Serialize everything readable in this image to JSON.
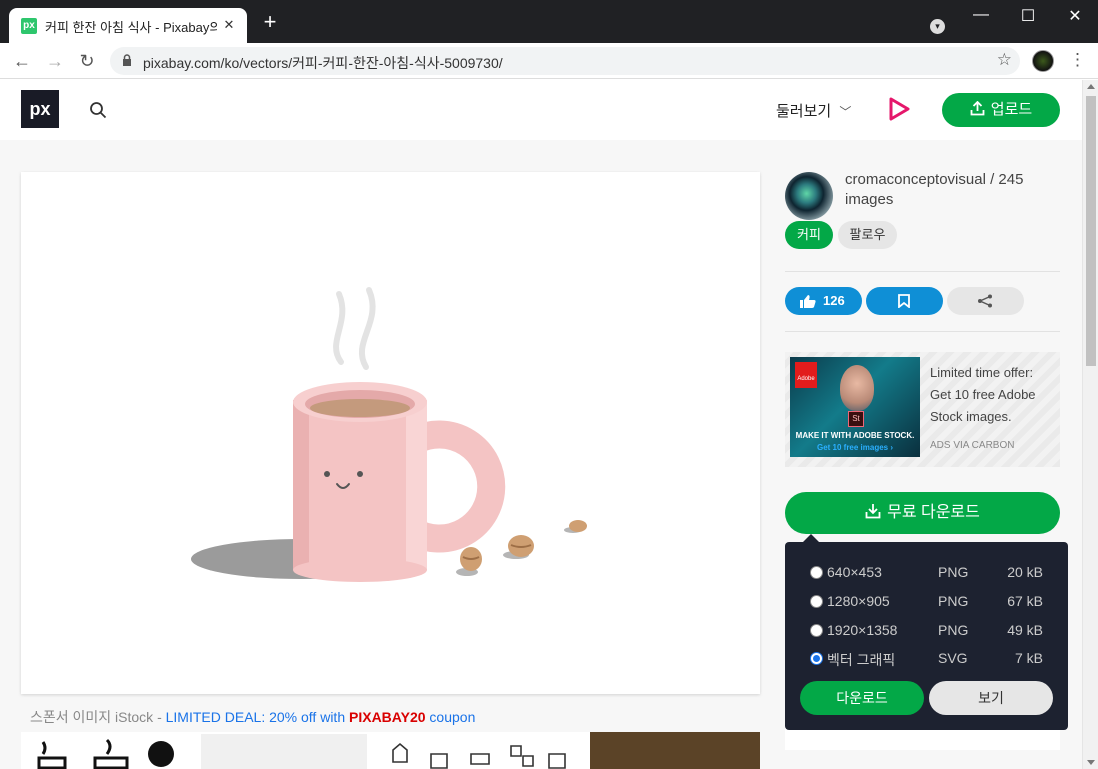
{
  "browser": {
    "tab_title": "커피 한잔 아침 식사 - Pixabay의",
    "tab_favicon": "px",
    "url": "pixabay.com/ko/vectors/커피-커피-한잔-아침-식사-5009730/"
  },
  "header": {
    "logo": "px",
    "explore_label": "둘러보기",
    "upload_label": "업로드"
  },
  "author": {
    "name_line": "cromaconceptovisual / 245 images",
    "coffee_label": "커피",
    "follow_label": "팔로우"
  },
  "actions": {
    "like_count": "126"
  },
  "ad": {
    "adobe_label": "Adobe",
    "stock_label": "St",
    "img_line1": "MAKE IT WITH ADOBE STOCK.",
    "img_line2": "Get 10 free images ›",
    "text": "Limited time offer: Get 10 free Adobe Stock images.",
    "via": "ADS VIA CARBON"
  },
  "download": {
    "button_label": "무료 다운로드",
    "options": [
      {
        "label": "640×453",
        "format": "PNG",
        "size": "20 kB",
        "selected": false
      },
      {
        "label": "1280×905",
        "format": "PNG",
        "size": "67 kB",
        "selected": false
      },
      {
        "label": "1920×1358",
        "format": "PNG",
        "size": "49 kB",
        "selected": false
      },
      {
        "label": "벡터 그래픽",
        "format": "SVG",
        "size": "7 kB",
        "selected": true
      }
    ],
    "download_label": "다운로드",
    "view_label": "보기"
  },
  "sponsor": {
    "prefix": "스폰서 이미지 iStock - ",
    "deal": "LIMITED DEAL: 20% off with ",
    "code": "PIXABAY20",
    "suffix": " coupon"
  },
  "colors": {
    "brand_green": "#03a847",
    "like_blue": "#0f8fd6",
    "dropdown_bg": "#1d2230"
  }
}
